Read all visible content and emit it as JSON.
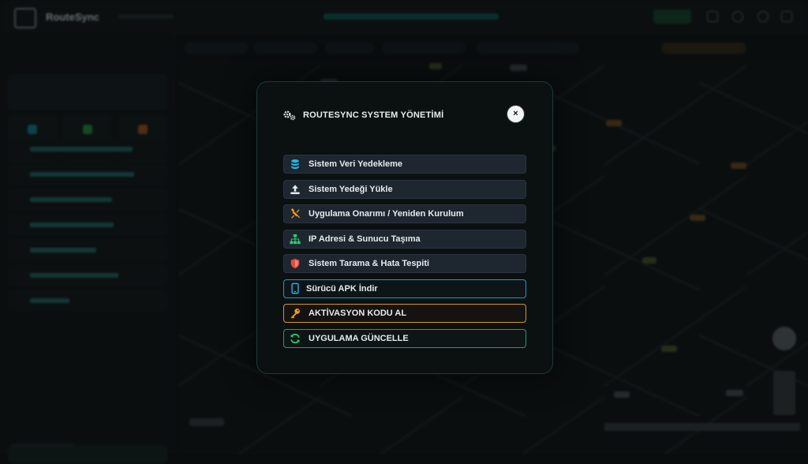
{
  "modal": {
    "title": "ROUTESYNC SYSTEM YÖNETİMİ",
    "close_label": "×",
    "items": [
      {
        "label": "Sistem Veri Yedekleme",
        "icon": "database-icon",
        "color": "#1fb8e8"
      },
      {
        "label": "Sistem Yedeği Yükle",
        "icon": "upload-icon",
        "color": "#e6ebee"
      },
      {
        "label": "Uygulama Onarımı / Yeniden Kurulum",
        "icon": "tools-icon",
        "color": "#f0a020"
      },
      {
        "label": "IP Adresi & Sunucu Taşıma",
        "icon": "network-icon",
        "color": "#2ecc71"
      },
      {
        "label": "Sistem Tarama & Hata Tespiti",
        "icon": "shield-icon",
        "color": "#e74c3c"
      },
      {
        "label": "Sürücü APK İndir",
        "icon": "mobile-icon",
        "color": "#1fb8e8"
      },
      {
        "label": "AKTİVASYON KODU AL",
        "icon": "key-icon",
        "color": "#f0a020"
      },
      {
        "label": "UYGULAMA GÜNCELLE",
        "icon": "refresh-icon",
        "color": "#2ecc71"
      }
    ]
  },
  "background": {
    "brand": "RouteSync"
  },
  "colors": {
    "accent": "#0fb7a4",
    "modal_border": "#1d3a36",
    "button_bg": "#1e2630"
  }
}
